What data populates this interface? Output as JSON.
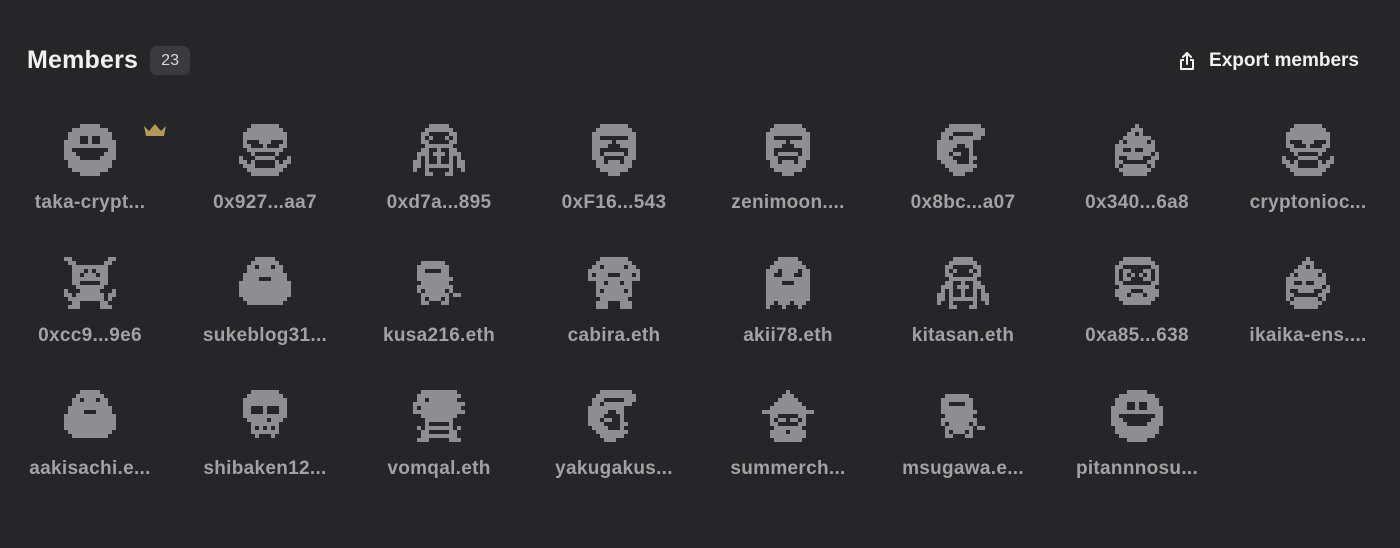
{
  "header": {
    "title": "Members",
    "count": "23",
    "export_label": "Export members"
  },
  "colors": {
    "background": "#262628",
    "avatar": "#8e8e90",
    "name": "#a2a2a5",
    "crown": "#b6975b"
  },
  "members": [
    {
      "name": "taka-crypt...",
      "avatar": "smiley-face",
      "crown": true
    },
    {
      "name": "0x927...aa7",
      "avatar": "alien-face"
    },
    {
      "name": "0xd7a...895",
      "avatar": "hooded-figure"
    },
    {
      "name": "0xF16...543",
      "avatar": "bearded-sunglasses-face"
    },
    {
      "name": "zenimoon....",
      "avatar": "bearded-sunglasses-face"
    },
    {
      "name": "0x8bc...a07",
      "avatar": "side-profile-face"
    },
    {
      "name": "0x340...6a8",
      "avatar": "flame-creature"
    },
    {
      "name": "cryptonioc...",
      "avatar": "alien-face"
    },
    {
      "name": "0xcc9...9e6",
      "avatar": "horned-creature"
    },
    {
      "name": "sukeblog31...",
      "avatar": "blob-creature"
    },
    {
      "name": "kusa216.eth",
      "avatar": "ninja-gun"
    },
    {
      "name": "cabira.eth",
      "avatar": "mushroom-creature"
    },
    {
      "name": "akii78.eth",
      "avatar": "ghost"
    },
    {
      "name": "kitasan.eth",
      "avatar": "hooded-figure"
    },
    {
      "name": "0xa85...638",
      "avatar": "goggles-creature"
    },
    {
      "name": "ikaika-ens....",
      "avatar": "flame-creature"
    },
    {
      "name": "aakisachi.e...",
      "avatar": "blob-creature"
    },
    {
      "name": "shibaken12...",
      "avatar": "skull"
    },
    {
      "name": "vomqal.eth",
      "avatar": "frog-creature"
    },
    {
      "name": "yakugakus...",
      "avatar": "side-profile-face"
    },
    {
      "name": "summerch...",
      "avatar": "witch"
    },
    {
      "name": "msugawa.e...",
      "avatar": "ninja-gun"
    },
    {
      "name": "pitannnosu...",
      "avatar": "smiley-face"
    }
  ]
}
